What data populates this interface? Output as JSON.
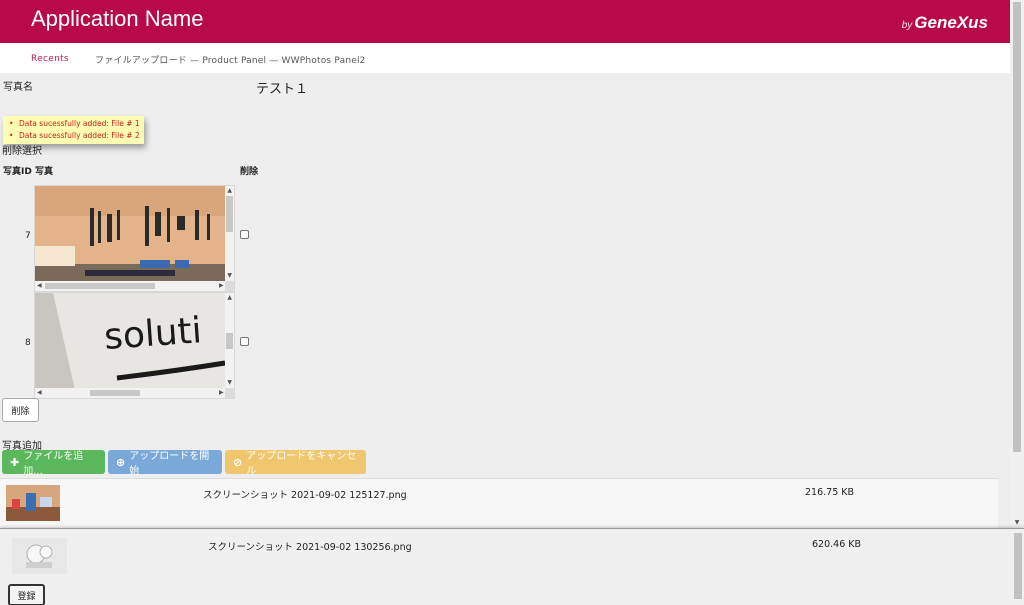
{
  "header": {
    "app_name": "Application Name",
    "brand_by": "by",
    "brand_name": "GeneXus",
    "color": "#b80a4a"
  },
  "topbar": {
    "recents": "Recents",
    "breadcrumb": "ファイルアップロード — Product Panel — WWPhotos Panel2"
  },
  "form": {
    "photo_name_label": "写真名",
    "photo_name_value": "テスト１",
    "messages": [
      "Data sucessfully added: File # 1",
      "Data sucessfully added: File # 2"
    ],
    "delete_select_label": "削除選択"
  },
  "grid": {
    "headers": {
      "id_photo": "写真ID 写真",
      "delete": "削除"
    },
    "rows": [
      {
        "id": "7",
        "image": "workbench-photo",
        "checked": false
      },
      {
        "id": "8",
        "image": "solution-photo",
        "checked": false
      }
    ],
    "delete_button": "削除"
  },
  "upload": {
    "label": "写真追加",
    "add_button": "ファイルを追加...",
    "start_button": "アップロードを開始",
    "cancel_button": "アップロードをキャンセル",
    "files": [
      {
        "name": "スクリーンショット 2021-09-02 125127.png",
        "size": "216.75 KB"
      },
      {
        "name": "スクリーンショット 2021-09-02 130256.png",
        "size": "620.46 KB"
      }
    ]
  },
  "register_button": "登録",
  "colors": {
    "add": "#5cb85c",
    "start": "#7aa9d9",
    "cancel": "#f0c66e",
    "message_bg": "#ffffb3",
    "message_text": "#cc1a1a"
  }
}
